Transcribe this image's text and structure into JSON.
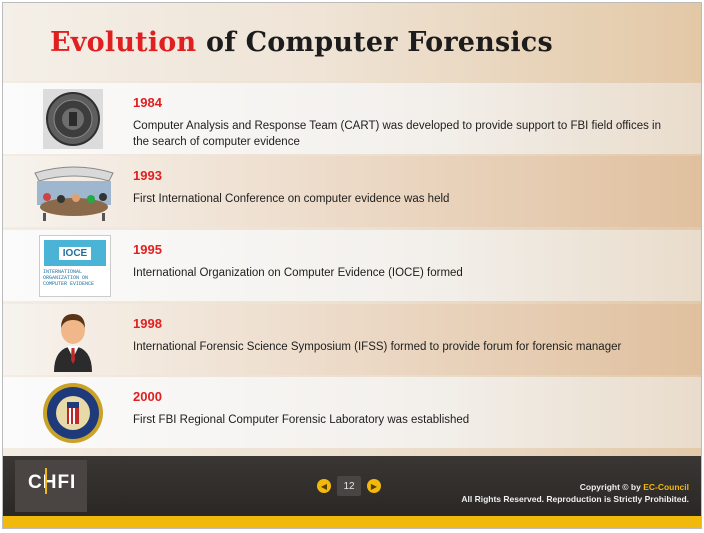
{
  "title": {
    "accent": "Evolution",
    "rest": " of Computer Forensics"
  },
  "timeline": [
    {
      "year": "1984",
      "text": "Computer Analysis and Response Team (CART) was developed to provide support to FBI field offices in the search of computer evidence",
      "icon": "fbi-seal-icon"
    },
    {
      "year": "1993",
      "text": "First International Conference on computer evidence was held",
      "icon": "conference-icon"
    },
    {
      "year": "1995",
      "text": "International Organization on Computer Evidence (IOCE) formed",
      "icon": "ioce-logo-icon",
      "logo_text": "IOCE",
      "logo_sub": "INTERNATIONAL ORGANIZATION ON COMPUTER EVIDENCE"
    },
    {
      "year": "1998",
      "text": "International Forensic Science Symposium (IFSS) formed to provide forum for forensic manager",
      "icon": "person-icon"
    },
    {
      "year": "2000",
      "text": "First FBI Regional Computer Forensic Laboratory was established",
      "icon": "fbi-badge-icon"
    }
  ],
  "footer": {
    "logo": "CHFI",
    "page_number": "12",
    "copyright_prefix": "Copyright © by ",
    "brand": "EC-Council",
    "rights": "All Rights Reserved. Reproduction is Strictly Prohibited."
  },
  "colors": {
    "accent_red": "#e02020",
    "footer_bg": "#2f2b29",
    "footer_yellow": "#f2b90d"
  }
}
